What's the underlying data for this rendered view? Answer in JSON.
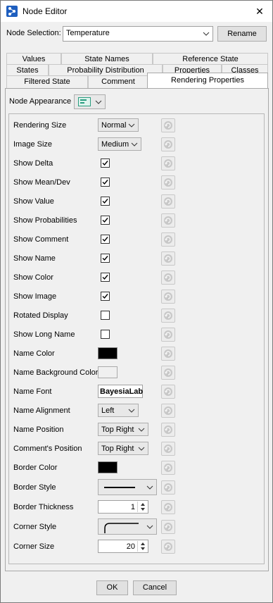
{
  "window": {
    "title": "Node Editor",
    "close_glyph": "✕"
  },
  "selection": {
    "label": "Node Selection:",
    "value": "Temperature",
    "rename_label": "Rename"
  },
  "tabs": {
    "row1": [
      "Values",
      "State Names",
      "Reference State"
    ],
    "row2": [
      "States",
      "Probability Distribution",
      "Properties",
      "Classes"
    ],
    "row3": [
      "Filtered State",
      "Comment",
      "Rendering Properties"
    ],
    "active": "Rendering Properties"
  },
  "appearance": {
    "label": "Node Appearance",
    "icon": "node-appearance-icon"
  },
  "rows": {
    "rendering_size": {
      "label": "Rendering Size",
      "value": "Normal"
    },
    "image_size": {
      "label": "Image Size",
      "value": "Medium"
    },
    "show_delta": {
      "label": "Show Delta",
      "checked": true
    },
    "show_mean_dev": {
      "label": "Show Mean/Dev",
      "checked": true
    },
    "show_value": {
      "label": "Show Value",
      "checked": true
    },
    "show_probabilities": {
      "label": "Show Probabilities",
      "checked": true
    },
    "show_comment": {
      "label": "Show Comment",
      "checked": true
    },
    "show_name": {
      "label": "Show Name",
      "checked": true
    },
    "show_color": {
      "label": "Show Color",
      "checked": true
    },
    "show_image": {
      "label": "Show Image",
      "checked": true
    },
    "rotated_display": {
      "label": "Rotated Display",
      "checked": false
    },
    "show_long_name": {
      "label": "Show Long Name",
      "checked": false
    },
    "name_color": {
      "label": "Name Color",
      "color": "#000000"
    },
    "name_background_color": {
      "label": "Name Background Color",
      "color": "#f0f0f0"
    },
    "name_font": {
      "label": "Name Font",
      "value": "BayesiaLab"
    },
    "name_alignment": {
      "label": "Name Alignment",
      "value": "Left"
    },
    "name_position": {
      "label": "Name Position",
      "value": "Top Right"
    },
    "comment_position": {
      "label": "Comment's Position",
      "value": "Top Right"
    },
    "border_color": {
      "label": "Border Color",
      "color": "#000000"
    },
    "border_style": {
      "label": "Border Style"
    },
    "border_thickness": {
      "label": "Border Thickness",
      "value": "1"
    },
    "corner_style": {
      "label": "Corner Style"
    },
    "corner_size": {
      "label": "Corner Size",
      "value": "20"
    }
  },
  "footer": {
    "ok_label": "OK",
    "cancel_label": "Cancel"
  }
}
